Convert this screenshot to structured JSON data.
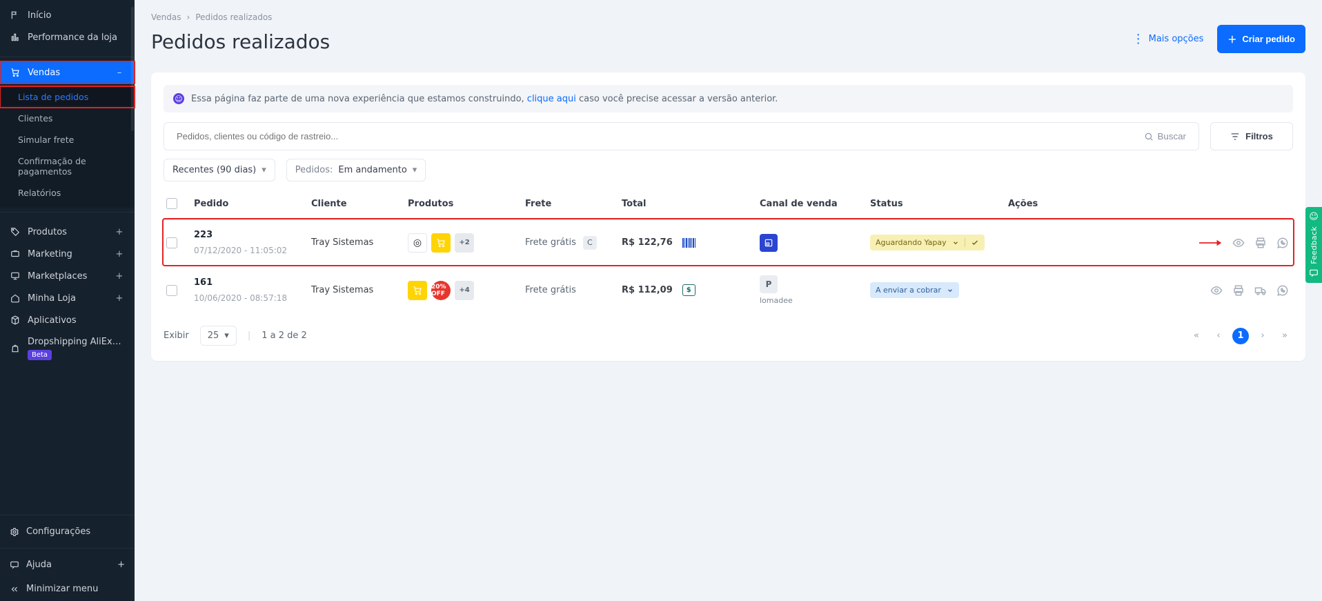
{
  "sidebar": {
    "items": [
      {
        "label": "Início",
        "suffix": ""
      },
      {
        "label": "Performance da loja",
        "suffix": ""
      },
      {
        "label": "Vendas",
        "suffix": "–"
      },
      {
        "label": "Produtos",
        "suffix": "+"
      },
      {
        "label": "Marketing",
        "suffix": "+"
      },
      {
        "label": "Marketplaces",
        "suffix": "+"
      },
      {
        "label": "Minha Loja",
        "suffix": "+"
      },
      {
        "label": "Aplicativos",
        "suffix": ""
      },
      {
        "label": "Dropshipping AliExpress",
        "suffix": ""
      }
    ],
    "beta": "Beta",
    "vendas_sub": [
      {
        "label": "Lista de pedidos"
      },
      {
        "label": "Clientes"
      },
      {
        "label": "Simular frete"
      },
      {
        "label": "Confirmação de pagamentos"
      },
      {
        "label": "Relatórios"
      }
    ],
    "config": "Configurações",
    "ajuda": "Ajuda",
    "ajuda_suffix": "+",
    "minimize": "Minimizar menu"
  },
  "breadcrumb": {
    "root": "Vendas",
    "current": "Pedidos realizados"
  },
  "page": {
    "title": "Pedidos realizados"
  },
  "header_actions": {
    "more": "Mais opções",
    "create": "Criar pedido"
  },
  "alert": {
    "pre": "Essa página faz parte de uma nova experiência que estamos construindo, ",
    "link": "clique aqui",
    "post": " caso você precise acessar a versão anterior."
  },
  "search": {
    "placeholder": "Pedidos, clientes ou código de rastreio...",
    "value": "",
    "button": "Buscar"
  },
  "filters_button": "Filtros",
  "toolbar": {
    "period_label": "Recentes (90 dias)",
    "orders_prefix": "Pedidos:",
    "orders_value": "Em andamento"
  },
  "columns": {
    "pedido": "Pedido",
    "cliente": "Cliente",
    "produtos": "Produtos",
    "frete": "Frete",
    "total": "Total",
    "canal": "Canal de venda",
    "status": "Status",
    "acoes": "Ações"
  },
  "rows": [
    {
      "id": "223",
      "datetime": "07/12/2020 - 11:05:02",
      "cliente": "Tray Sistemas",
      "extra_products": "+2",
      "frete": "Frete grátis",
      "frete_chip": "C",
      "total": "R$ 122,76",
      "canal_label": "",
      "status": "Aguardando Yapay",
      "status_color": "yellow",
      "has_check": true,
      "has_barcode": true,
      "has_money": false,
      "show_truck": false,
      "show_wa": true,
      "canal": "blue"
    },
    {
      "id": "161",
      "datetime": "10/06/2020 - 08:57:18",
      "cliente": "Tray Sistemas",
      "extra_products": "+4",
      "frete": "Frete grátis",
      "frete_chip": "",
      "total": "R$ 112,09",
      "canal_label": "lomadee",
      "status": "A enviar a cobrar",
      "status_color": "blue",
      "has_check": false,
      "has_barcode": false,
      "has_money": true,
      "show_truck": true,
      "show_wa": true,
      "canal": "pill"
    }
  ],
  "footer": {
    "exibir_label": "Exibir",
    "per_page": "25",
    "range": "1 a 2 de 2",
    "page": "1"
  },
  "feedback": {
    "label": "Feedback"
  }
}
